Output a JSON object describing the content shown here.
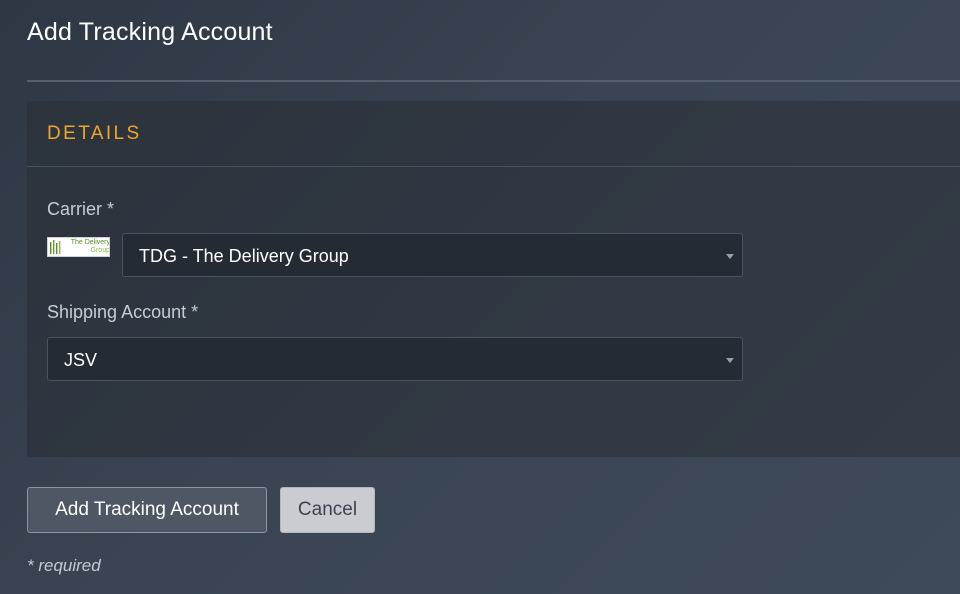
{
  "page": {
    "title": "Add Tracking Account"
  },
  "details": {
    "heading": "DETAILS",
    "carrier": {
      "label": "Carrier *",
      "logo_line1": "The Delivery",
      "logo_line2": "Group",
      "selected": "TDG - The Delivery Group"
    },
    "shipping_account": {
      "label": "Shipping Account *",
      "selected": "JSV"
    }
  },
  "actions": {
    "add_label": "Add Tracking Account",
    "cancel_label": "Cancel"
  },
  "footer": {
    "required_note": "* required"
  },
  "colors": {
    "accent": "#f0a52b",
    "background": "#363f4b",
    "panel": "#2f3640",
    "select_bg": "#252b34"
  }
}
